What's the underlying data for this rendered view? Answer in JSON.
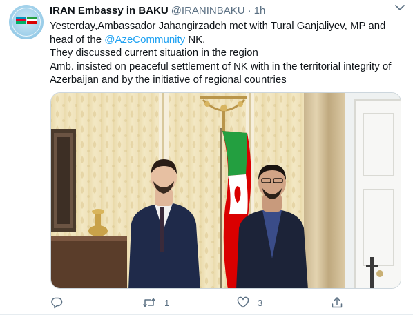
{
  "tweet": {
    "display_name": "IRAN Embassy in BAKU",
    "handle": "@IRANINBAKU",
    "separator": "·",
    "time": "1h",
    "text": {
      "line1": "Yesterday,Ambassador Jahangirzadeh met with Tural Ganjaliyev, MP and",
      "line2_pre": "head of the ",
      "mention": "@AzeCommunity",
      "line2_post": " NK.",
      "line3": "They discussed current situation in the region",
      "line4": "Amb. insisted on peaceful settlement of NK with in the territorial integrity of",
      "line5": "Azerbaijan and by the initiative of regional countries"
    }
  },
  "actions": {
    "reply_count": "",
    "retweet_count": "1",
    "like_count": "3"
  },
  "colors": {
    "accent": "#1da1f2",
    "muted": "#5b7083",
    "text": "#0f1419",
    "flag_green": "#239f40",
    "flag_red": "#da0000"
  },
  "icons": [
    "chevron-down-icon",
    "reply-icon",
    "retweet-icon",
    "heart-icon",
    "share-icon"
  ]
}
